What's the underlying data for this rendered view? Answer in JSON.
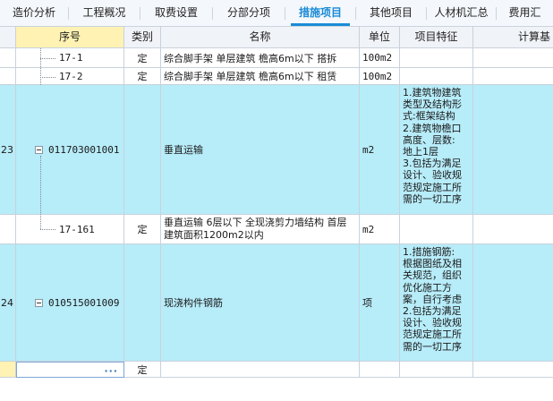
{
  "tabs": [
    {
      "label": "造价分析",
      "active": false
    },
    {
      "label": "工程概况",
      "active": false
    },
    {
      "label": "取费设置",
      "active": false
    },
    {
      "label": "分部分项",
      "active": false
    },
    {
      "label": "措施项目",
      "active": true
    },
    {
      "label": "其他项目",
      "active": false
    },
    {
      "label": "人材机汇总",
      "active": false
    },
    {
      "label": "费用汇",
      "active": false
    }
  ],
  "columns": {
    "seq": "序号",
    "type": "类别",
    "name": "名称",
    "unit": "单位",
    "features": "项目特征",
    "calc": "计算基"
  },
  "rows": [
    {
      "num": "",
      "code": "17-1",
      "type": "定",
      "name": "综合脚手架 单层建筑 檐高6m以下 搭拆",
      "unit": "100m2",
      "features": ""
    },
    {
      "num": "",
      "code": "17-2",
      "type": "定",
      "name": "综合脚手架 单层建筑 檐高6m以下 租赁",
      "unit": "100m2",
      "features": ""
    },
    {
      "num": "23",
      "code": "011703001001",
      "type": "",
      "name": "垂直运输",
      "unit": "m2",
      "features": "1.建筑物建筑\n类型及结构形\n式:框架结构\n2.建筑物檐口\n高度、层数:\n地上1层\n3.包括为满足\n设计、验收规\n范规定施工所\n需的一切工序"
    },
    {
      "num": "",
      "code": "17-161",
      "type": "定",
      "name": "垂直运输 6层以下 全现浇剪力墙结构 首层建筑面积1200m2以内",
      "unit": "m2",
      "features": ""
    },
    {
      "num": "24",
      "code": "010515001009",
      "type": "",
      "name": "现浇构件钢筋",
      "unit": "项",
      "features": "1.措施钢筋:\n根据图纸及相\n关规范，组织\n优化施工方\n案，自行考虑\n2.包括为满足\n设计、验收规\n范规定施工所\n需的一切工序"
    },
    {
      "num": "",
      "code": "",
      "type": "定",
      "name": "",
      "unit": "",
      "features": "",
      "more": "···"
    }
  ],
  "colors": {
    "accent": "#1a8bd6",
    "highlight_row": "#b7ecf9",
    "header_selected": "#fff2b3"
  }
}
